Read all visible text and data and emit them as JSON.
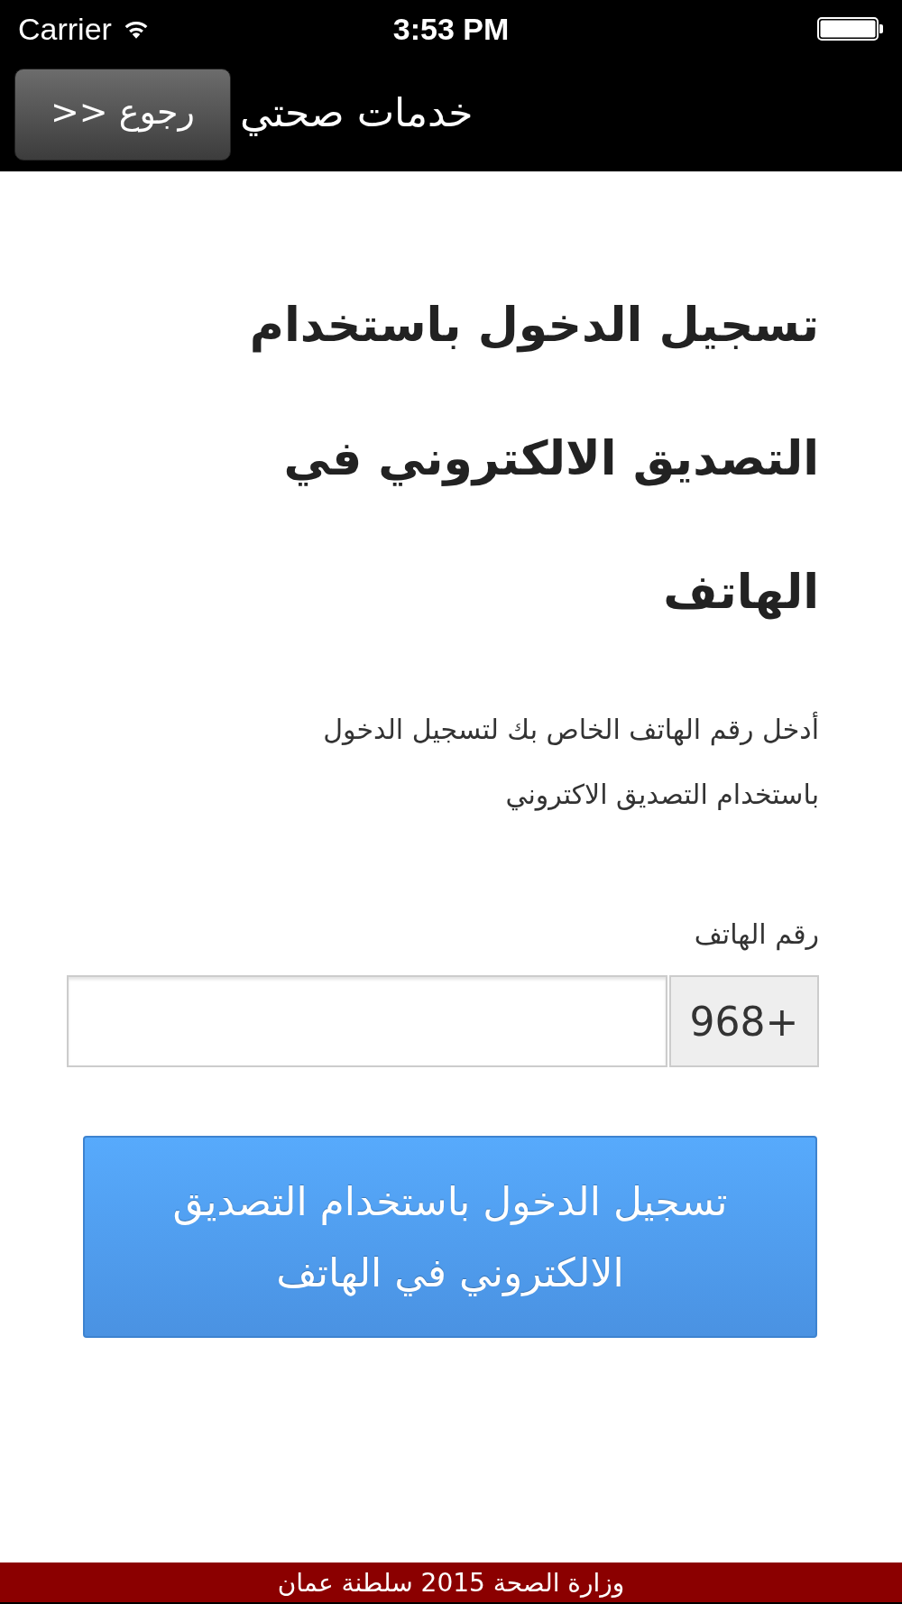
{
  "status_bar": {
    "carrier": "Carrier",
    "time": "3:53 PM"
  },
  "nav_bar": {
    "back_button": ">> رجوع",
    "title": "خدمات صحتي"
  },
  "heading": "تسجيل الدخول باستخدام التصديق الالكتروني في الهاتف",
  "instructions": "أدخل رقم الهاتف الخاص بك لتسجيل الدخول باستخدام التصديق الاكتروني",
  "phone_field": {
    "label": "رقم الهاتف",
    "prefix": "968+"
  },
  "submit_button": "تسجيل الدخول باستخدام التصديق الالكتروني في الهاتف",
  "footer": "وزارة الصحة 2015 سلطنة عمان"
}
